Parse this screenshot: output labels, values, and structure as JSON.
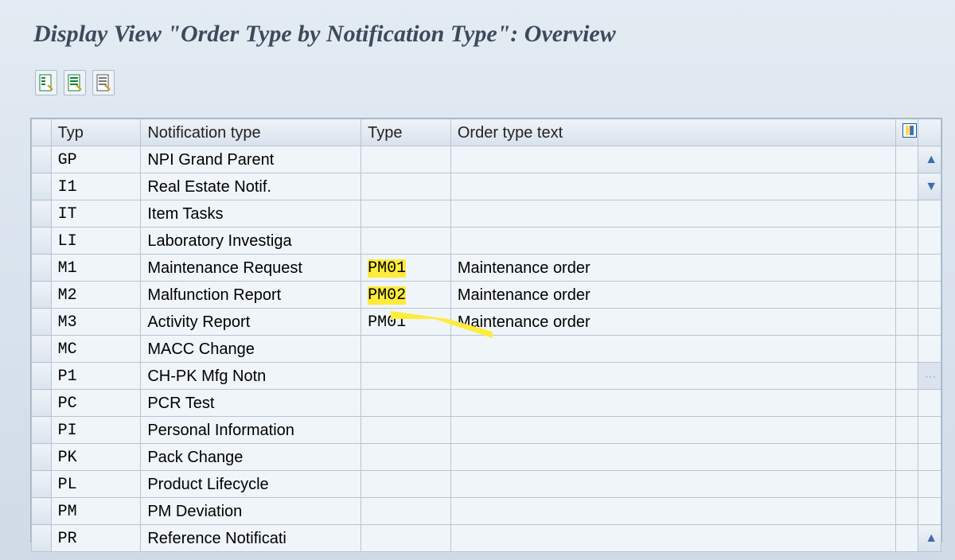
{
  "page_title": "Display View \"Order Type by Notification Type\": Overview",
  "columns": {
    "typ": "Typ",
    "notification_type": "Notification type",
    "type": "Type",
    "order_type_text": "Order type text"
  },
  "rows": [
    {
      "typ": "GP",
      "ntyp": "NPI Grand Parent",
      "type": "",
      "text": ""
    },
    {
      "typ": "I1",
      "ntyp": "Real Estate Notif.",
      "type": "",
      "text": ""
    },
    {
      "typ": "IT",
      "ntyp": "Item Tasks",
      "type": "",
      "text": ""
    },
    {
      "typ": "LI",
      "ntyp": "Laboratory Investiga",
      "type": "",
      "text": ""
    },
    {
      "typ": "M1",
      "ntyp": "Maintenance Request",
      "type": "PM01",
      "text": "Maintenance order",
      "hl": true
    },
    {
      "typ": "M2",
      "ntyp": "Malfunction Report",
      "type": "PM02",
      "text": "Maintenance order",
      "hl": true
    },
    {
      "typ": "M3",
      "ntyp": "Activity Report",
      "type": "PM01",
      "text": "Maintenance order"
    },
    {
      "typ": "MC",
      "ntyp": "MACC Change",
      "type": "",
      "text": ""
    },
    {
      "typ": "P1",
      "ntyp": "CH-PK Mfg Notn",
      "type": "",
      "text": ""
    },
    {
      "typ": "PC",
      "ntyp": "PCR Test",
      "type": "",
      "text": ""
    },
    {
      "typ": "PI",
      "ntyp": "Personal Information",
      "type": "",
      "text": ""
    },
    {
      "typ": "PK",
      "ntyp": "Pack Change",
      "type": "",
      "text": ""
    },
    {
      "typ": "PL",
      "ntyp": "Product Lifecycle",
      "type": "",
      "text": ""
    },
    {
      "typ": "PM",
      "ntyp": "PM Deviation",
      "type": "",
      "text": ""
    },
    {
      "typ": "PR",
      "ntyp": "Reference Notificati",
      "type": "",
      "text": ""
    }
  ]
}
